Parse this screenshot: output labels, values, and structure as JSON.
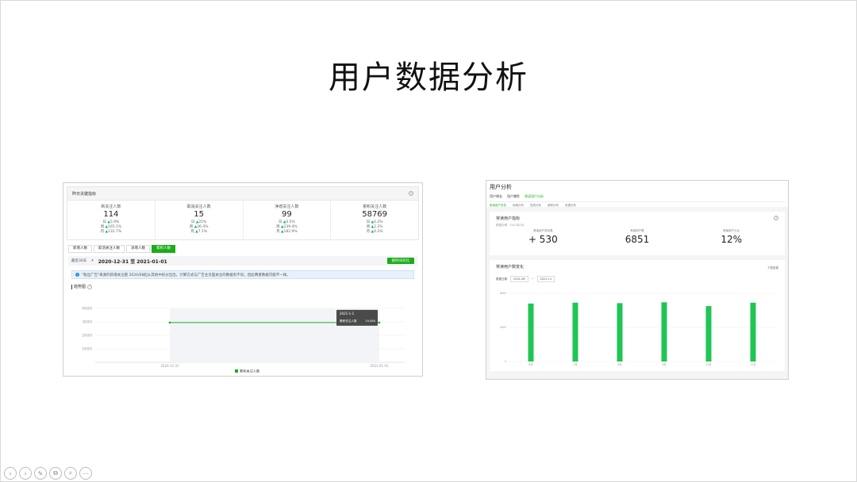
{
  "slide": {
    "title": "用户数据分析"
  },
  "left_panel": {
    "header_title": "昨日关键指标",
    "metrics": [
      {
        "label": "新关注人数",
        "value": "114",
        "day": "5.9%",
        "week": "165.1%",
        "month": "132.7%"
      },
      {
        "label": "取消关注人数",
        "value": "15",
        "day": "25%",
        "week": "36.4%",
        "month": "7.1%"
      },
      {
        "label": "净增关注人数",
        "value": "99",
        "day": "0.5%",
        "week": "239.4%",
        "month": "182.9%"
      },
      {
        "label": "累积关注人数",
        "value": "58769",
        "day": "0.2%",
        "week": "2.2%",
        "month": "4.2%"
      }
    ],
    "row_labels": {
      "day": "日",
      "week": "周",
      "month": "月"
    },
    "tabs": [
      "新增人数",
      "取消关注人数",
      "净增人数",
      "累积人数"
    ],
    "active_tab": 3,
    "range_label": "最近30天",
    "range_value": "2020-12-31 至 2021-01-01",
    "export_button": "按时间对比",
    "notice": "\"粉丝广告\"来源的新增关注量 2020/08起从其他中拆分出出，计算方式与广告主页面关注的数据有不同，因此两者数据可能不一样。",
    "trend_label": "趋势图",
    "chart_data": {
      "type": "line",
      "x": [
        "2020-12-31",
        "2021-01-01"
      ],
      "series": [
        {
          "name": "累积关注人数",
          "values": [
            29480,
            29480
          ]
        }
      ],
      "yticks": [
        40000,
        30000,
        20000,
        10000
      ],
      "ylim": [
        0,
        40000
      ],
      "tooltip_title": "2021-1-1",
      "tooltip_label": "累积关注人数",
      "tooltip_value": "29,480",
      "legend": "累积关注人数",
      "color": "#1aad19"
    }
  },
  "right_panel": {
    "title": "用户分析",
    "nav": [
      "用户增长",
      "用户属性",
      "常读用户分析"
    ],
    "active_nav": 2,
    "sub_nav": [
      "常读用户总览",
      "地域分布",
      "性别分布",
      "频率分布",
      "渗透分布"
    ],
    "active_sub_nav": 0,
    "card1_title": "常读用户指标",
    "card1_sub": "数据日期 · 2021年1月",
    "kpis": [
      {
        "label": "常读用户变化数",
        "value": "+ 530"
      },
      {
        "label": "常读用户数",
        "value": "6851"
      },
      {
        "label": "常读用户占比",
        "value": "12%"
      }
    ],
    "card2_title": "常读用户数变化",
    "download_label": "下载数据",
    "date_label": "数据日期",
    "date_from": "2021-08",
    "date_to": "2021-11",
    "chart_data": {
      "type": "bar",
      "categories": [
        "6月",
        "7月",
        "8月",
        "9月",
        "10月",
        "11月"
      ],
      "values": [
        6800,
        6900,
        6850,
        6950,
        6500,
        6900
      ],
      "yticks": [
        8000,
        4000,
        0
      ],
      "ylim": [
        0,
        8000
      ],
      "color": "#1fc654"
    }
  },
  "toolbar": {
    "buttons": [
      {
        "name": "prev-icon",
        "glyph": "‹"
      },
      {
        "name": "next-icon",
        "glyph": "›"
      },
      {
        "name": "pen-icon",
        "glyph": "✎"
      },
      {
        "name": "copy-icon",
        "glyph": "⧉"
      },
      {
        "name": "zoom-icon",
        "glyph": "⌕"
      },
      {
        "name": "more-icon",
        "glyph": "⋯"
      }
    ]
  }
}
